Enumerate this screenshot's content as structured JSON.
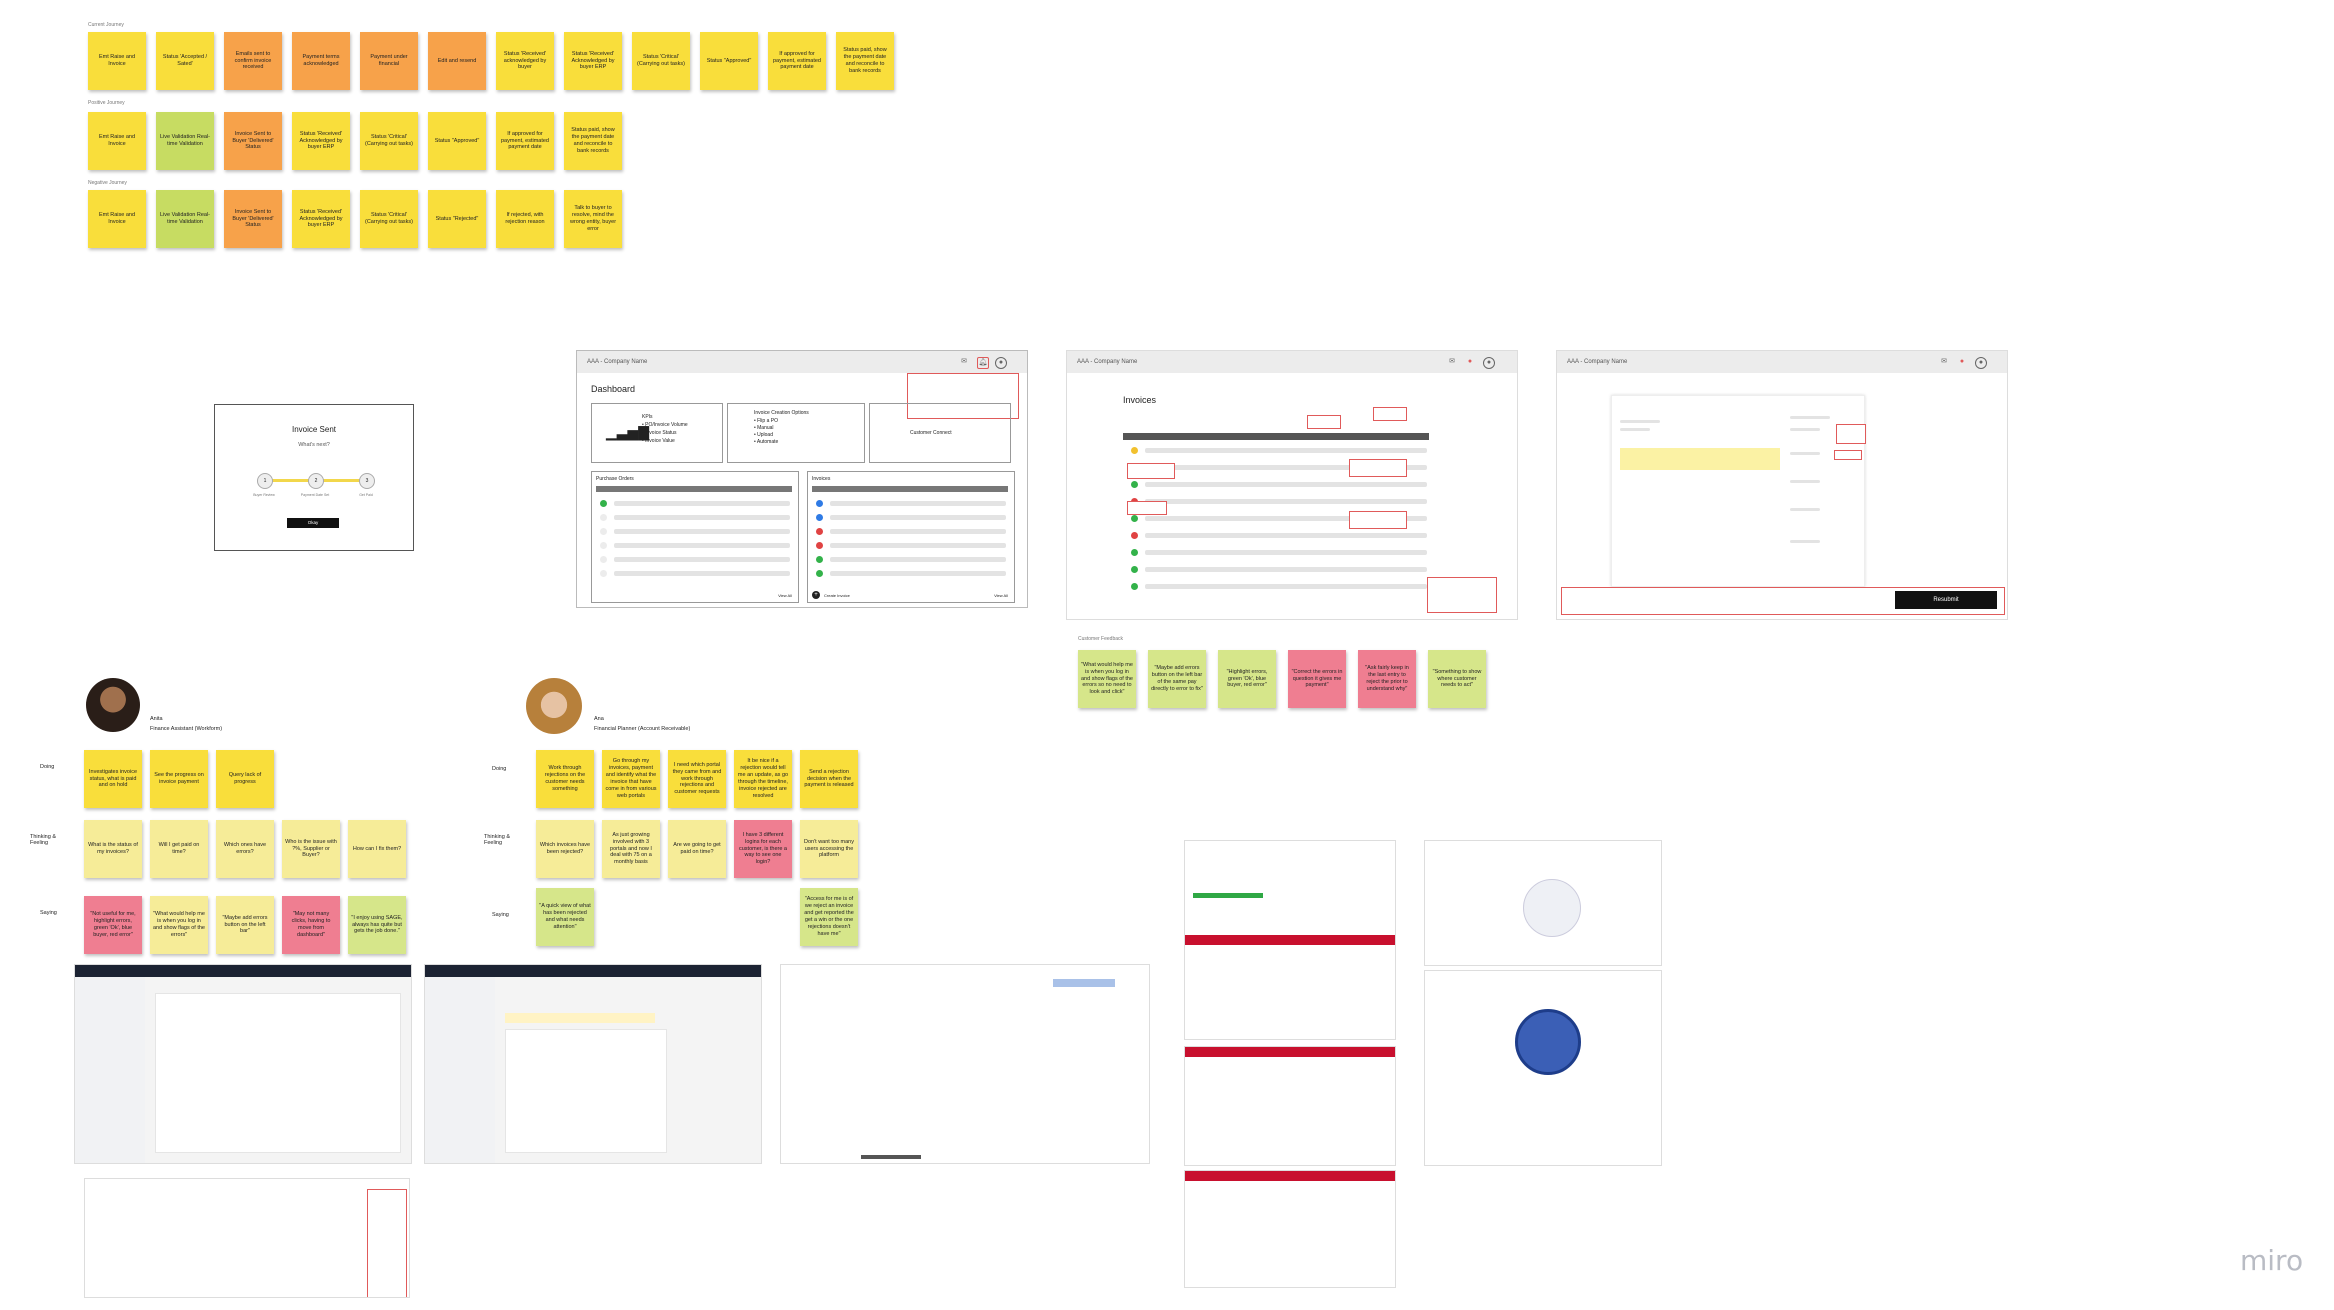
{
  "journeys": {
    "row1_label": "Current Journey",
    "row2_label": "Positive Journey",
    "row3_label": "Negative Journey",
    "row1": [
      {
        "t": "Emt Raise and Invoice",
        "c": "y"
      },
      {
        "t": "Status 'Accepted / Sated'",
        "c": "y"
      },
      {
        "t": "Emails sent to confirm invoice received",
        "c": "o"
      },
      {
        "t": "Payment terms acknowledged",
        "c": "o"
      },
      {
        "t": "Payment under financial",
        "c": "o"
      },
      {
        "t": "Edit and resend",
        "c": "o"
      },
      {
        "t": "Status 'Received' acknowledged by buyer",
        "c": "y"
      },
      {
        "t": "Status 'Received' Acknowledged by buyer ERP",
        "c": "y"
      },
      {
        "t": "Status 'Critical' (Carrying out tasks)",
        "c": "y"
      },
      {
        "t": "Status \"Approved\"",
        "c": "y"
      },
      {
        "t": "If approved for payment, estimated payment date",
        "c": "y"
      },
      {
        "t": "Status paid, show the payment date and reconcile to bank records",
        "c": "y"
      }
    ],
    "row2": [
      {
        "t": "Emt Raise and Invoice",
        "c": "y"
      },
      {
        "t": "Live Validation Real-time Validation",
        "c": "g"
      },
      {
        "t": "Invoice Sent to Buyer 'Delivered' Status",
        "c": "o"
      },
      {
        "t": "Status 'Received' Acknowledged by buyer ERP",
        "c": "y"
      },
      {
        "t": "Status 'Critical' (Carrying out tasks)",
        "c": "y"
      },
      {
        "t": "Status \"Approved\"",
        "c": "y"
      },
      {
        "t": "If approved for payment, estimated payment date",
        "c": "y"
      },
      {
        "t": "Status paid, show the payment date and reconcile to bank records",
        "c": "y"
      }
    ],
    "row3": [
      {
        "t": "Emt Raise and Invoice",
        "c": "y"
      },
      {
        "t": "Live Validation Real-time Validation",
        "c": "g"
      },
      {
        "t": "Invoice Sent to Buyer 'Delivered' Status",
        "c": "o"
      },
      {
        "t": "Status 'Received' Acknowledged by buyer ERP",
        "c": "y"
      },
      {
        "t": "Status 'Critical' (Carrying out tasks)",
        "c": "y"
      },
      {
        "t": "Status \"Rejected\"",
        "c": "y"
      },
      {
        "t": "If rejected, with rejection reason",
        "c": "y"
      },
      {
        "t": "Talk to buyer to resolve, mind the wrong entity, buyer error",
        "c": "y"
      }
    ]
  },
  "invoice_sent": {
    "title": "Invoice Sent",
    "subtitle": "What's next?",
    "steps": [
      "1",
      "2",
      "3"
    ],
    "step_labels": [
      "Buyer Review",
      "Payment Date Set",
      "Get Paid"
    ],
    "button": "Okay"
  },
  "dashboard": {
    "company": "AAA - Company Name",
    "title": "Dashboard",
    "kpi_title": "KPIs",
    "kpi_items": [
      "• PO/Invoice Volume",
      "• Invoice Status",
      "• Invoice Value"
    ],
    "creation_title": "Invoice Creation Options",
    "creation_items": [
      "• Flip a PO",
      "• Manual",
      "• Upload",
      "• Automate"
    ],
    "customer_connect": "Customer Connect",
    "po_title": "Purchase Orders",
    "inv_title": "Invoices",
    "create_invoice": "Create Invoice",
    "view_all": "View All"
  },
  "invoices": {
    "company": "AAA - Company Name",
    "title": "Invoices"
  },
  "invoice_detail": {
    "company": "AAA - Company Name",
    "resubmit": "Resubmit"
  },
  "feedback": {
    "label": "Customer Feedback",
    "notes": [
      {
        "t": "\"What would help me is when you log in and show flags of the errors so no need to look and click\"",
        "c": "lg"
      },
      {
        "t": "\"Maybe add errors button on the left bar of the same pay directly to error to fix\"",
        "c": "lg"
      },
      {
        "t": "\"Highlight errors, green 'Ok', blue buyer, red error\"",
        "c": "lg"
      },
      {
        "t": "\"Correct the errors in question it gives me payment\"",
        "c": "p"
      },
      {
        "t": "\"Ask fairly keep in the last entry to reject the prior to understand why\"",
        "c": "p"
      },
      {
        "t": "\"Something to show where customer needs to act\"",
        "c": "lg"
      }
    ]
  },
  "persona1": {
    "name": "Anita",
    "role": "Finance Assistant (Workform)",
    "doing_label": "Doing",
    "thinking_label": "Thinking & Feeling",
    "saying_label": "Saying",
    "doing": [
      "Investigates invoice status, what is paid and on hold",
      "See the progress on invoice payment",
      "Query lack of progress"
    ],
    "thinking": [
      "What is the status of my invoices?",
      "Will I get paid on time?",
      "Which ones have errors?",
      "Who is the issue with ?%, Supplier or Buyer?",
      "How can I fix them?"
    ],
    "saying": [
      "\"Not useful for me, highlight errors, green 'Ok', blue buyer, red error\"",
      "\"What would help me is when you log in and show flags of the errors\"",
      "\"Maybe add errors button on the left bar\"",
      "\"May not many clicks, having to move from dashboard\"",
      "\"I enjoy using SAGE, always has quite but gets the job done.\""
    ]
  },
  "persona2": {
    "name": "Ana",
    "role": "Financial Planner (Account Receivable)",
    "doing_label": "Doing",
    "thinking_label": "Thinking & Feeling",
    "saying_label": "Saying",
    "doing": [
      "Work through rejections on the customer needs something",
      "Go through my invoices, payment and identify what the invoice that have come in from various web portals",
      "I need which portal they came from and work through rejections and customer requests",
      "It be nice if a rejection would tell me an update, as go through the timeline, invoice rejected are resolved",
      "Send a rejection decision when the payment is released"
    ],
    "thinking": [
      "Which invoices have been rejected?",
      "As just growing involved with 3 portals and now I deal with 75 on a monthly basis",
      "Are we going to get paid on time?",
      "I have 3 different logins for each customer, is there a way to see one login?",
      "Don't want too many users accessing the platform"
    ],
    "saying": [
      "\"A quick view of what has been rejected and what needs attention\"",
      "\"Access for me is of we reject an invoice and get reported the get a win or the one rejections doesn't have me\""
    ]
  },
  "watermark": "miro"
}
